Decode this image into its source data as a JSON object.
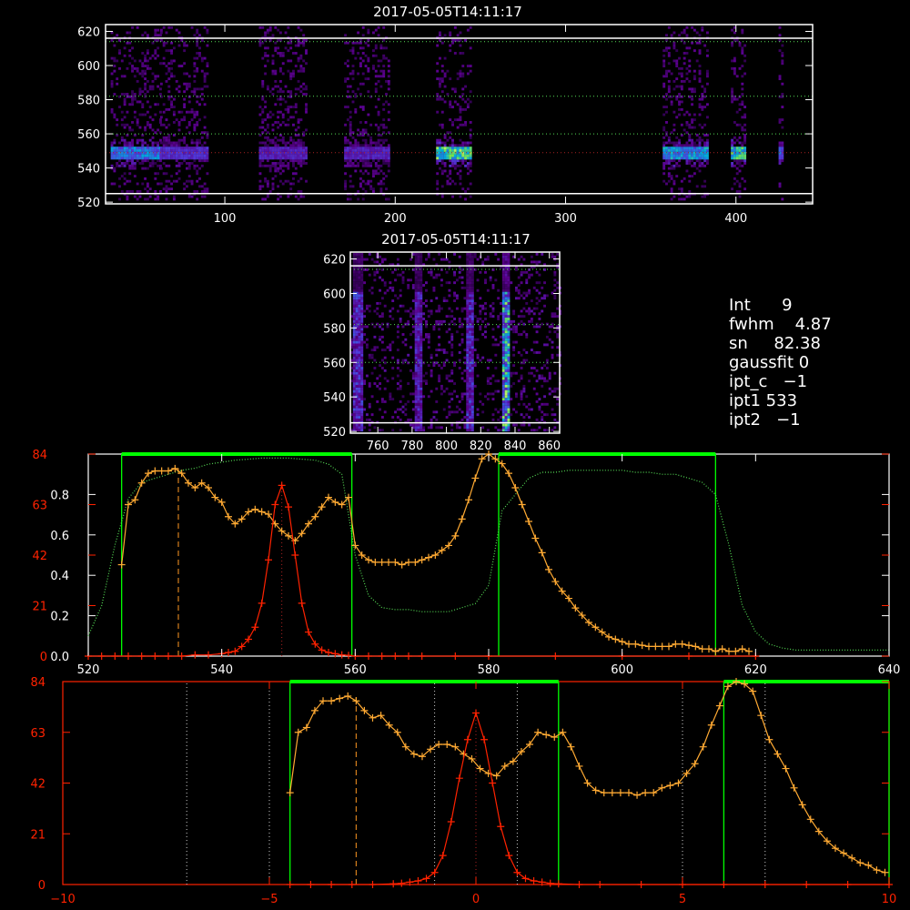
{
  "titles": {
    "top": "2017-05-05T14:11:17",
    "middle": "2017-05-05T14:11:17"
  },
  "info": {
    "lines": [
      "Int      9",
      "fwhm    4.87",
      "sn     82.38",
      "gaussfit 0",
      "ipt_c   −1",
      "ipt1 533",
      "ipt2   −1"
    ]
  },
  "colors": {
    "axis": "#ffffff",
    "orange": "#ffaa33",
    "red": "#ff2200",
    "green": "#00ff00",
    "palegreen": "#55dd55",
    "darkred_dot": "#aa2222",
    "dotted_white": "#cccccc",
    "orange_dash": "#ff9922"
  },
  "chart_data": [
    {
      "type": "heatmap",
      "name": "top-spectrogram",
      "title": "2017-05-05T14:11:17",
      "xlim": [
        30,
        445
      ],
      "ylim": [
        519,
        624
      ],
      "xticks": [
        100,
        200,
        300,
        400
      ],
      "yticks": [
        520,
        540,
        560,
        580,
        600,
        620
      ],
      "hlines_white": [
        525,
        616
      ],
      "hlines_green_dotted": [
        560,
        582,
        614
      ],
      "hlines_red_dotted": [
        549
      ],
      "bands": [
        {
          "x0": 33,
          "x1": 62,
          "intensity": 0.75
        },
        {
          "x0": 62,
          "x1": 90,
          "intensity": 0.55
        },
        {
          "x0": 120,
          "x1": 148,
          "intensity": 0.5
        },
        {
          "x0": 170,
          "x1": 197,
          "intensity": 0.5
        },
        {
          "x0": 224,
          "x1": 245,
          "intensity": 0.95
        },
        {
          "x0": 357,
          "x1": 384,
          "intensity": 0.8
        },
        {
          "x0": 397,
          "x1": 405,
          "intensity": 0.9
        },
        {
          "x0": 425,
          "x1": 428,
          "intensity": 0.7
        }
      ]
    },
    {
      "type": "heatmap",
      "name": "middle-spectrogram",
      "title": "2017-05-05T14:11:17",
      "xlim": [
        744,
        866
      ],
      "ylim": [
        519,
        624
      ],
      "xticks": [
        760,
        780,
        800,
        820,
        840,
        860
      ],
      "yticks": [
        520,
        540,
        560,
        580,
        600,
        620
      ],
      "hlines_white": [
        525,
        616
      ],
      "hlines_green_dotted": [
        560,
        582,
        614
      ],
      "columns": [
        {
          "x": 748,
          "intensity": 0.6
        },
        {
          "x": 783,
          "intensity": 0.55
        },
        {
          "x": 813,
          "intensity": 0.6
        },
        {
          "x": 834,
          "intensity": 0.95
        }
      ]
    },
    {
      "type": "line",
      "name": "spectrum-wavelength",
      "xlim": [
        520,
        640
      ],
      "xticks": [
        520,
        540,
        560,
        580,
        600,
        620,
        640
      ],
      "yticks_right": [
        0.0,
        0.2,
        0.4,
        0.6,
        0.8
      ],
      "yticks_left": [
        0,
        21,
        42,
        63,
        84
      ],
      "ylim_left": [
        0,
        84
      ],
      "ylim_right": [
        0,
        1.0
      ],
      "green_windows": [
        [
          525,
          559.5
        ],
        [
          581.5,
          614
        ]
      ],
      "orange_dash_x": 533.5,
      "red_dot_x": 549,
      "series": [
        {
          "name": "",
          "color": "orange",
          "x": [
            525,
            526,
            527,
            528,
            529,
            530,
            531,
            532,
            533,
            534,
            535,
            536,
            537,
            538,
            539,
            540,
            541,
            542,
            543,
            544,
            545,
            546,
            547,
            548,
            549,
            550,
            551,
            552,
            553,
            554,
            555,
            556,
            557,
            558,
            559,
            560,
            561,
            562,
            563,
            564,
            565,
            566,
            567,
            568,
            569,
            570,
            571,
            572,
            573,
            574,
            575,
            576,
            577,
            578,
            579,
            580,
            581,
            582,
            583,
            584,
            585,
            586,
            587,
            588,
            589,
            590,
            591,
            592,
            593,
            594,
            595,
            596,
            597,
            598,
            599,
            600,
            601,
            602,
            603,
            604,
            605,
            606,
            607,
            608,
            609,
            610,
            611,
            612,
            613,
            614,
            615,
            616,
            617,
            618,
            619
          ],
          "y": [
            38,
            63,
            65,
            72,
            76,
            77,
            77,
            77,
            78,
            76,
            72,
            70,
            72,
            70,
            66,
            64,
            58,
            55,
            57,
            60,
            61,
            60,
            59,
            55,
            52,
            50,
            48,
            51,
            55,
            58,
            62,
            66,
            64,
            63,
            66,
            46,
            42,
            40,
            39,
            39,
            39,
            39,
            38,
            39,
            39,
            40,
            41,
            42,
            44,
            46,
            50,
            57,
            65,
            74,
            82,
            84,
            82,
            80,
            76,
            70,
            63,
            56,
            49,
            43,
            36,
            31,
            27,
            24,
            20,
            17,
            14,
            12,
            10,
            8,
            7,
            6,
            5,
            5,
            4.5,
            4,
            4,
            4,
            4,
            5,
            5,
            4.5,
            4,
            3,
            3,
            2,
            3,
            2,
            2,
            3,
            2
          ]
        },
        {
          "name": "",
          "color": "red",
          "x": [
            520,
            522,
            524,
            526,
            528,
            530,
            532,
            534,
            536,
            538,
            540,
            541,
            542,
            543,
            544,
            545,
            546,
            547,
            548,
            549,
            550,
            551,
            552,
            553,
            554,
            555,
            556,
            557,
            558,
            559,
            560,
            562,
            564,
            566,
            568,
            570,
            575,
            580,
            590,
            600,
            610,
            620
          ],
          "y": [
            0,
            0,
            0,
            0,
            0,
            0,
            0,
            0,
            0.5,
            0.5,
            1,
            1.5,
            2,
            4,
            7,
            12,
            22,
            40,
            63,
            71,
            62,
            42,
            22,
            10,
            5,
            2.5,
            1.5,
            1,
            0.5,
            0.3,
            0,
            0,
            0,
            0,
            0,
            0,
            0,
            0,
            0,
            0,
            0,
            0
          ]
        },
        {
          "name": "",
          "color": "palegreen",
          "x": [
            520,
            522,
            524,
            526,
            528,
            530,
            532,
            534,
            536,
            538,
            540,
            542,
            544,
            546,
            548,
            550,
            552,
            554,
            556,
            558,
            560,
            562,
            564,
            566,
            568,
            570,
            572,
            574,
            576,
            578,
            580,
            582,
            584,
            586,
            588,
            590,
            592,
            594,
            596,
            598,
            600,
            602,
            604,
            606,
            608,
            610,
            612,
            614,
            616,
            618,
            620,
            622,
            624,
            626,
            628,
            630,
            632,
            634,
            636,
            638,
            640
          ],
          "y_right": [
            0.1,
            0.25,
            0.55,
            0.78,
            0.86,
            0.88,
            0.9,
            0.92,
            0.93,
            0.95,
            0.96,
            0.97,
            0.975,
            0.98,
            0.98,
            0.98,
            0.975,
            0.97,
            0.95,
            0.9,
            0.5,
            0.3,
            0.24,
            0.23,
            0.23,
            0.22,
            0.22,
            0.22,
            0.24,
            0.26,
            0.35,
            0.72,
            0.8,
            0.88,
            0.91,
            0.91,
            0.92,
            0.92,
            0.92,
            0.92,
            0.92,
            0.91,
            0.91,
            0.9,
            0.9,
            0.88,
            0.86,
            0.8,
            0.55,
            0.25,
            0.12,
            0.06,
            0.04,
            0.03,
            0.03,
            0.03,
            0.03,
            0.03,
            0.03,
            0.03,
            0.03
          ]
        }
      ]
    },
    {
      "type": "line",
      "name": "spectrum-offset",
      "xlim": [
        -10,
        10
      ],
      "xticks": [
        -10,
        -5,
        0,
        5,
        10
      ],
      "yticks_left": [
        0,
        21,
        42,
        63,
        84
      ],
      "ylim_left": [
        0,
        84
      ],
      "green_windows": [
        [
          -4.5,
          2.0
        ],
        [
          6.0,
          10.0
        ]
      ],
      "orange_dash_x": -2.9,
      "red_dot_x": 0,
      "white_dotted_x": [
        -7,
        -5,
        -1,
        1,
        5,
        7
      ],
      "series": [
        {
          "name": "",
          "color": "orange",
          "x": [
            -4.5,
            -4.3,
            -4.1,
            -3.9,
            -3.7,
            -3.5,
            -3.3,
            -3.1,
            -2.9,
            -2.7,
            -2.5,
            -2.3,
            -2.1,
            -1.9,
            -1.7,
            -1.5,
            -1.3,
            -1.1,
            -0.9,
            -0.7,
            -0.5,
            -0.3,
            -0.1,
            0.1,
            0.3,
            0.5,
            0.7,
            0.9,
            1.1,
            1.3,
            1.5,
            1.7,
            1.9,
            2.1,
            2.3,
            2.5,
            2.7,
            2.9,
            3.1,
            3.3,
            3.5,
            3.7,
            3.9,
            4.1,
            4.3,
            4.5,
            4.7,
            4.9,
            5.1,
            5.3,
            5.5,
            5.7,
            5.9,
            6.1,
            6.3,
            6.5,
            6.7,
            6.9,
            7.1,
            7.3,
            7.5,
            7.7,
            7.9,
            8.1,
            8.3,
            8.5,
            8.7,
            8.9,
            9.1,
            9.3,
            9.5,
            9.7,
            9.9
          ],
          "y": [
            38,
            63,
            65,
            72,
            76,
            76,
            77,
            78,
            76,
            72,
            69,
            70,
            66,
            63,
            57,
            54,
            53,
            56,
            58,
            58,
            57,
            54,
            52,
            48,
            46,
            45,
            49,
            51,
            55,
            58,
            63,
            62,
            61,
            63,
            57,
            49,
            42,
            39,
            38,
            38,
            38,
            38,
            37,
            38,
            38,
            40,
            41,
            42,
            46,
            50,
            57,
            66,
            74,
            82,
            84,
            83,
            80,
            70,
            60,
            54,
            48,
            40,
            33,
            27,
            22,
            18,
            15,
            13,
            11,
            9,
            8,
            6,
            5
          ]
        },
        {
          "name": "",
          "color": "red",
          "x": [
            -4.5,
            -4,
            -3.5,
            -3,
            -2.5,
            -2,
            -1.8,
            -1.6,
            -1.4,
            -1.2,
            -1.0,
            -0.8,
            -0.6,
            -0.4,
            -0.2,
            0,
            0.2,
            0.4,
            0.6,
            0.8,
            1.0,
            1.2,
            1.4,
            1.6,
            1.8,
            2.0,
            2.5,
            3,
            4,
            5,
            6,
            7,
            8,
            9,
            10
          ],
          "y": [
            0,
            0,
            0,
            0,
            0,
            0.3,
            0.5,
            1,
            1.5,
            2.5,
            5,
            12,
            26,
            44,
            60,
            71,
            60,
            42,
            24,
            12,
            5,
            2.5,
            1.5,
            1,
            0.5,
            0.3,
            0,
            0,
            0,
            0,
            0,
            0,
            0,
            0,
            0
          ]
        }
      ]
    }
  ]
}
